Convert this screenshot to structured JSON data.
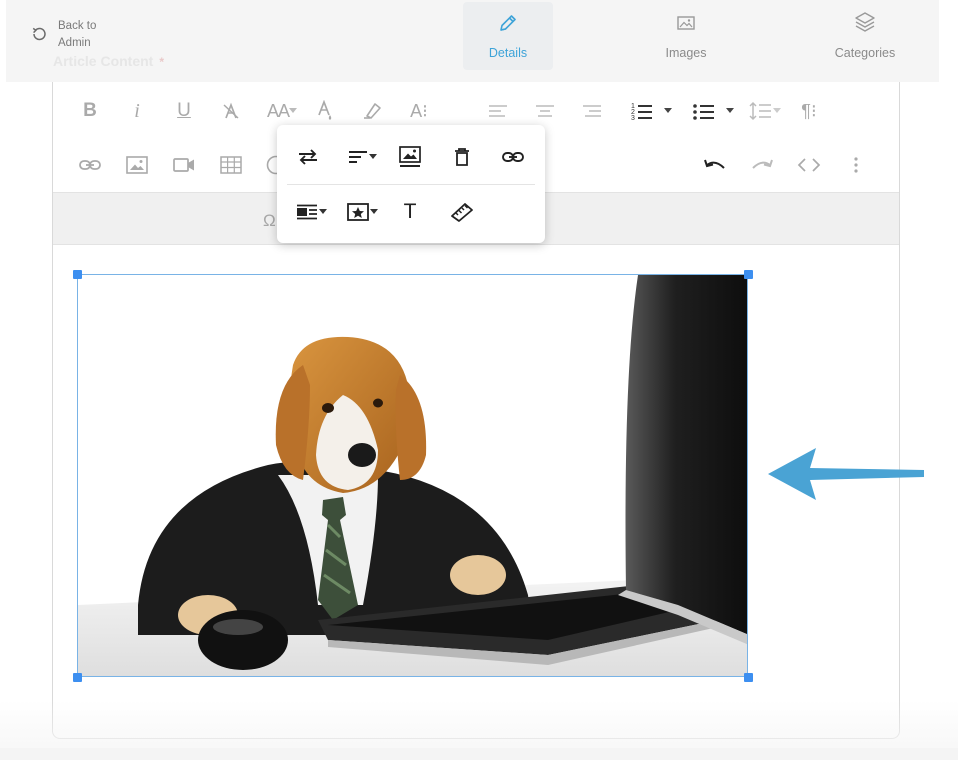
{
  "nav": {
    "back_label": "Back to Admin",
    "field_label": "Article Content",
    "required_mark": "*",
    "tabs": [
      {
        "label": "Details",
        "icon": "pencil-icon",
        "active": true
      },
      {
        "label": "Images",
        "icon": "image-icon",
        "active": false
      },
      {
        "label": "Categories",
        "icon": "layers-icon",
        "active": false
      }
    ]
  },
  "toolbar": {
    "row1": [
      "bold-icon",
      "italic-icon",
      "underline-icon",
      "clear-format-icon",
      "font-size-icon",
      "text-color-icon",
      "highlighter-icon",
      "paragraph-style-icon",
      "align-left-icon",
      "align-center-icon",
      "align-right-icon",
      "ordered-list-icon",
      "unordered-list-icon",
      "line-height-icon",
      "paragraph-format-icon"
    ],
    "row2": [
      "insert-link-icon",
      "insert-image-icon",
      "insert-video-icon",
      "insert-table-icon",
      "emoji-icon",
      "undo-icon",
      "redo-icon",
      "code-view-icon",
      "more-icon"
    ],
    "row3": [
      "special-characters-icon"
    ],
    "labels": {
      "bold": "B",
      "italic": "i",
      "underline": "U",
      "font_size": "AA",
      "paragraph_style": "A⁝",
      "paragraph_format": "¶⁝",
      "omega": "Ω",
      "text_style": "T"
    }
  },
  "image_popup": {
    "row1": [
      "replace-image-icon",
      "image-align-icon",
      "image-caption-icon",
      "remove-image-icon",
      "image-link-icon"
    ],
    "row2": [
      "image-display-icon",
      "image-style-icon",
      "alt-text-icon",
      "change-size-icon"
    ]
  },
  "image": {
    "description_icon": "photo-dog-laptop",
    "colors": {
      "selection": "#3d8ff0",
      "accent": "#3da3d8",
      "arrow": "#4aa3d4"
    }
  }
}
